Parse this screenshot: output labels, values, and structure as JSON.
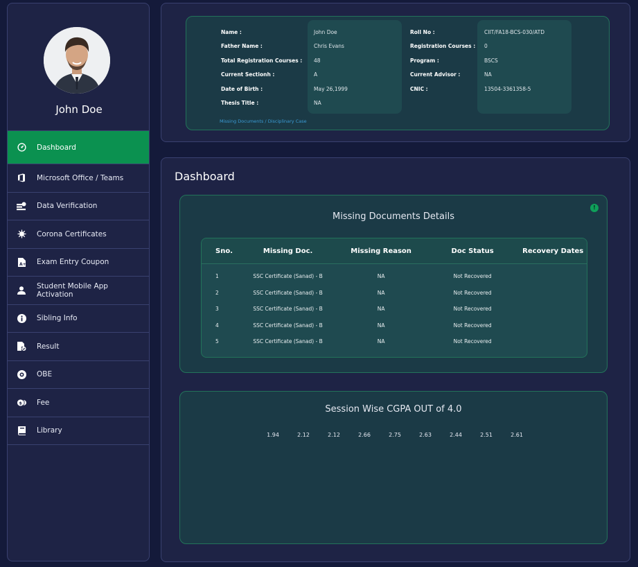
{
  "profile": {
    "name": "John Doe"
  },
  "sidebar": {
    "items": [
      {
        "label": "Dashboard",
        "icon": "dashboard-icon",
        "active": true
      },
      {
        "label": "Microsoft Office / Teams",
        "icon": "office-icon"
      },
      {
        "label": "Data Verification",
        "icon": "data-verification-icon"
      },
      {
        "label": "Corona Certificates",
        "icon": "virus-icon"
      },
      {
        "label": "Exam Entry Coupon",
        "icon": "coupon-icon"
      },
      {
        "label": "Student Mobile App Activation",
        "icon": "user-icon"
      },
      {
        "label": "Sibling Info",
        "icon": "info-icon"
      },
      {
        "label": "Result",
        "icon": "result-icon"
      },
      {
        "label": "OBE",
        "icon": "obe-icon"
      },
      {
        "label": "Fee",
        "icon": "coins-icon"
      },
      {
        "label": "Library",
        "icon": "book-icon"
      }
    ]
  },
  "student_info": {
    "left": [
      {
        "label": "Name :",
        "value": "John Doe"
      },
      {
        "label": "Father Name :",
        "value": "Chris Evans"
      },
      {
        "label": "Total Registration Courses :",
        "value": "48"
      },
      {
        "label": "Current Sectionh :",
        "value": "A"
      },
      {
        "label": "Date of Birth :",
        "value": "May 26,1999"
      },
      {
        "label": "Thesis Title :",
        "value": "NA"
      }
    ],
    "right": [
      {
        "label": "Roll No :",
        "value": "CIIT/FA18-BCS-030/ATD"
      },
      {
        "label": "Registration Courses :",
        "value": "0"
      },
      {
        "label": "Program :",
        "value": "BSCS"
      },
      {
        "label": "Current Advisor :",
        "value": "NA"
      },
      {
        "label": "CNIC :",
        "value": "13504-3361358-5"
      }
    ],
    "link": "Missing Documents / Disciplinary Case"
  },
  "main": {
    "title": "Dashboard",
    "missing_docs": {
      "title": "Missing Documents Details",
      "columns": [
        "Sno.",
        "Missing Doc.",
        "Missing Reason",
        "Doc Status",
        "Recovery Dates"
      ],
      "rows": [
        [
          "1",
          "SSC Certificate (Sanad) - B",
          "NA",
          "Not Recovered",
          ""
        ],
        [
          "2",
          "SSC Certificate (Sanad) - B",
          "NA",
          "Not Recovered",
          ""
        ],
        [
          "3",
          "SSC Certificate (Sanad) - B",
          "NA",
          "Not Recovered",
          ""
        ],
        [
          "4",
          "SSC Certificate (Sanad) - B",
          "NA",
          "Not Recovered",
          ""
        ],
        [
          "5",
          "SSC Certificate (Sanad) - B",
          "NA",
          "Not Recovered",
          ""
        ]
      ]
    },
    "cgpa": {
      "title": "Session Wise CGPA OUT of 4.0",
      "values": [
        "1.94",
        "2.12",
        "2.12",
        "2.66",
        "2.75",
        "2.63",
        "2.44",
        "2.51",
        "2.61"
      ]
    }
  },
  "colors": {
    "background": "#141a3a",
    "panel": "#1e2345",
    "accent": "#0b9150",
    "card": "#1b3a46",
    "link": "#3a9bd6"
  }
}
